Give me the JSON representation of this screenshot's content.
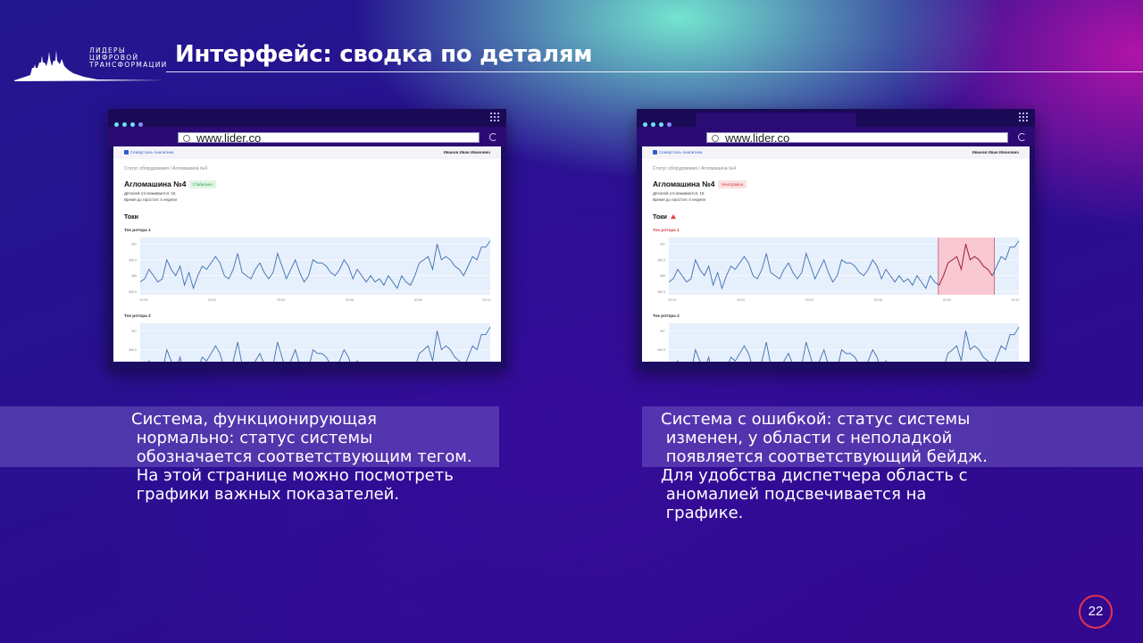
{
  "slide": {
    "title": "Интерфейс: сводка по деталям",
    "logo_lines": [
      "ЛИДЕРЫ",
      "ЦИФРОВОЙ",
      "ТРАНСФОРМАЦИИ"
    ],
    "page_number": "22"
  },
  "browsers": [
    {
      "url": "www.lider.co",
      "app_name": "Северсталь Аналитика",
      "user_name": "Иванов Иван Иванович",
      "breadcrumb": "Статус оборудования  /  Агломашина №4",
      "machine_title": "Агломашина №4",
      "status_badge": "Стабильно",
      "meta_line1": "Деталей отслеживается: 15",
      "meta_line2": "Время до простоя: 4 недели",
      "section_title": "Токи",
      "chart1_label": "Ток ротора 1",
      "chart2_label": "Ток ротора 2"
    },
    {
      "url": "www.lider.co",
      "app_name": "Северсталь Аналитика",
      "user_name": "Иванов Иван Иванович",
      "breadcrumb": "Статус оборудования  /  Агломашина №4",
      "machine_title": "Агломашина №4",
      "status_badge": "Неисправна",
      "meta_line1": "Деталей отслеживается: 15",
      "meta_line2": "Время до простоя: 4 недели",
      "section_title": "Токи",
      "chart1_label": "Ток ротора 1",
      "chart2_label": "Ток ротора 2"
    }
  ],
  "captions": {
    "left": "Система, функционирующая\n нормально: статус системы\n обозначается соответствующим тегом.\n На этой странице можно посмотреть\n графики важных показателей.",
    "right": "Система с ошибкой: статус системы\n изменен, у области с неполадкой\n появляется соответствующий бейдж.\nДля удобства диспетчера область с\n аномалией подсвечивается на\n графике."
  },
  "chart_data": [
    {
      "type": "line",
      "title": "Ток ротора 1",
      "x_ticks": [
        "00:00",
        "00:02",
        "00:04",
        "00:06",
        "00:08",
        "00:10"
      ],
      "y_ticks": [
        "365.5",
        "366",
        "366.5",
        "367"
      ],
      "ylim": [
        365.4,
        367.2
      ],
      "values": [
        365.8,
        365.9,
        366.2,
        366.0,
        365.8,
        365.9,
        366.5,
        366.2,
        366.0,
        366.3,
        365.7,
        366.1,
        365.6,
        366.0,
        366.3,
        366.2,
        366.4,
        366.6,
        366.4,
        366.0,
        365.9,
        366.2,
        366.7,
        366.1,
        366.0,
        365.9,
        366.2,
        366.4,
        366.1,
        365.9,
        366.1,
        366.7,
        366.3,
        365.9,
        366.2,
        366.5,
        366.1,
        365.8,
        366.0,
        366.5,
        366.4,
        366.4,
        366.3,
        366.1,
        366.0,
        366.2,
        366.5,
        366.3,
        365.9,
        366.2,
        366.0,
        365.8,
        366.0,
        365.8,
        365.9,
        365.7,
        366.0,
        365.8,
        365.6,
        366.0,
        365.8,
        365.7,
        366.0,
        366.4,
        366.5,
        366.6,
        366.2,
        367.0,
        366.5,
        366.6,
        366.5,
        366.3,
        366.2,
        366.0,
        366.3,
        366.6,
        366.5,
        366.9,
        366.9,
        367.1
      ]
    },
    {
      "type": "line",
      "title": "Ток ротора 2",
      "y_ticks": [
        "366.5",
        "367"
      ],
      "values": [
        365.8,
        365.9,
        366.2,
        366.0,
        365.8,
        365.9,
        366.5,
        366.2,
        366.0,
        366.3,
        365.7,
        366.1,
        365.6,
        366.0,
        366.3,
        366.2,
        366.4,
        366.6,
        366.4,
        366.0,
        365.9,
        366.2,
        366.7,
        366.1,
        366.0,
        365.9,
        366.2,
        366.4,
        366.1,
        365.9,
        366.1,
        366.7,
        366.3,
        365.9,
        366.2,
        366.5,
        366.1,
        365.8,
        366.0,
        366.5,
        366.4,
        366.4,
        366.3,
        366.1,
        366.0,
        366.2,
        366.5,
        366.3,
        365.9,
        366.2,
        366.0,
        365.8,
        366.0,
        365.8,
        365.9,
        365.7,
        366.0,
        365.8,
        365.6,
        366.0,
        365.8,
        365.7,
        366.0,
        366.4,
        366.5,
        366.6,
        366.2,
        367.0,
        366.5,
        366.6,
        366.5,
        366.3,
        366.2,
        366.0,
        366.3,
        366.6,
        366.5,
        366.9,
        366.9,
        367.1
      ]
    }
  ],
  "anomaly_range": [
    0.77,
    0.93
  ],
  "colors": {
    "line": "#3d6fae",
    "grid_bg": "#e6effc",
    "anomaly_fill": "#f9c9d3",
    "anomaly_line": "#b0273a",
    "badge_ok": "#2b9b49",
    "badge_err": "#d63a46"
  }
}
